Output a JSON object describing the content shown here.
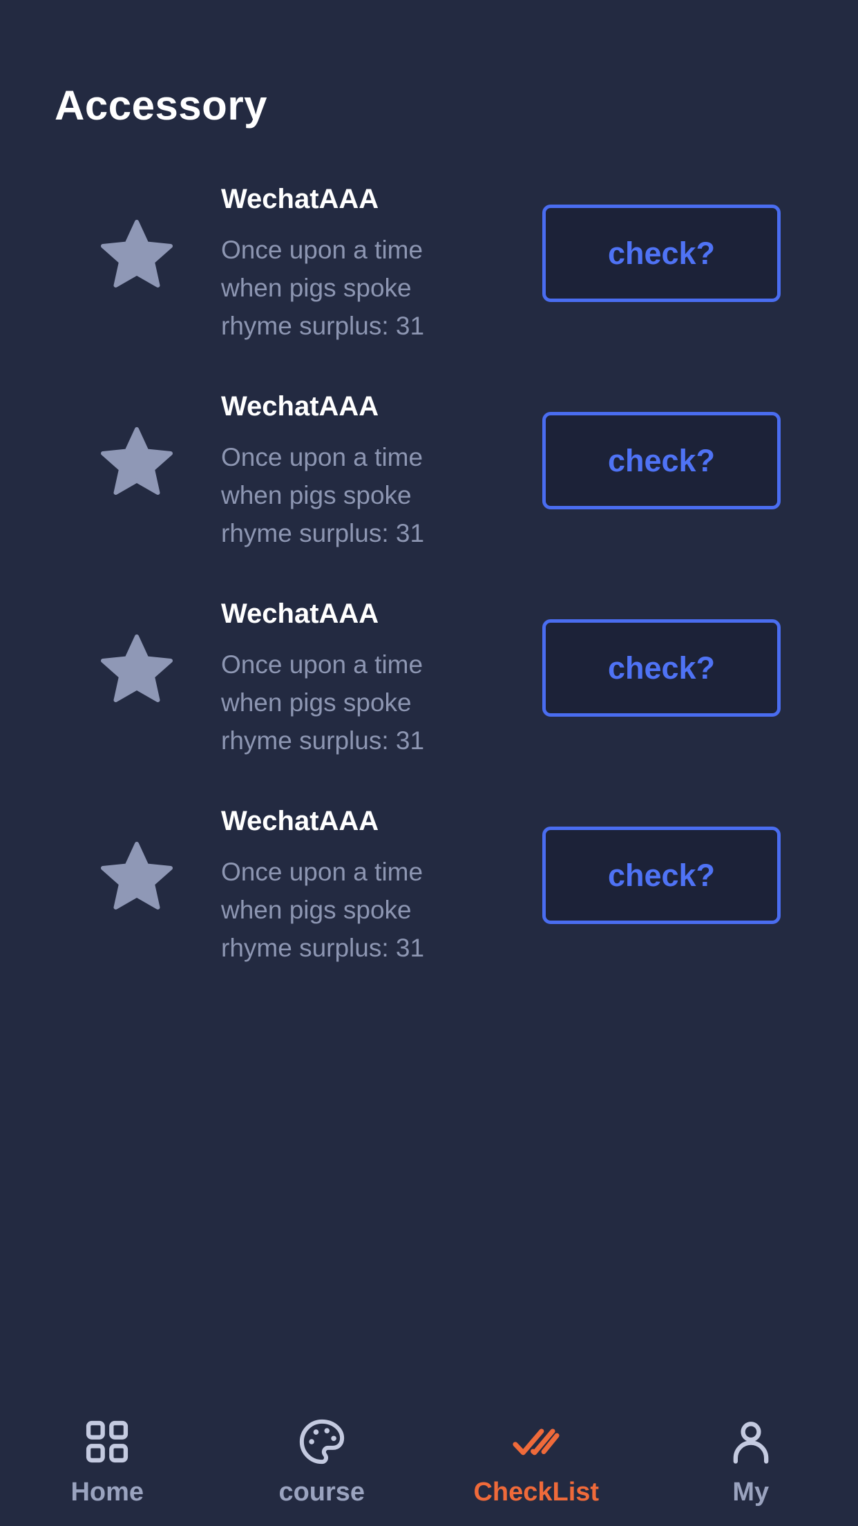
{
  "page": {
    "title": "Accessory"
  },
  "items": [
    {
      "title": "WechatAAA",
      "line1": "Once upon a time",
      "line2": "when pigs spoke",
      "line3": "rhyme surplus: 31",
      "button": "check?"
    },
    {
      "title": "WechatAAA",
      "line1": "Once upon a time",
      "line2": "when pigs spoke",
      "line3": "rhyme surplus: 31",
      "button": "check?"
    },
    {
      "title": "WechatAAA",
      "line1": "Once upon a time",
      "line2": "when pigs spoke",
      "line3": "rhyme surplus: 31",
      "button": "check?"
    },
    {
      "title": "WechatAAA",
      "line1": "Once upon a time",
      "line2": "when pigs spoke",
      "line3": "rhyme surplus: 31",
      "button": "check?"
    }
  ],
  "tabbar": {
    "tabs": [
      {
        "label": "Home",
        "icon": "grid-icon",
        "active": false
      },
      {
        "label": "course",
        "icon": "palette-icon",
        "active": false
      },
      {
        "label": "CheckList",
        "icon": "double-check-icon",
        "active": true
      },
      {
        "label": "My",
        "icon": "person-icon",
        "active": false
      }
    ]
  },
  "colors": {
    "background": "#232a41",
    "accent_blue": "#4a6df0",
    "active_tab": "#ef6a3a",
    "muted_text": "#8d96b2",
    "star": "#8f98b6"
  }
}
